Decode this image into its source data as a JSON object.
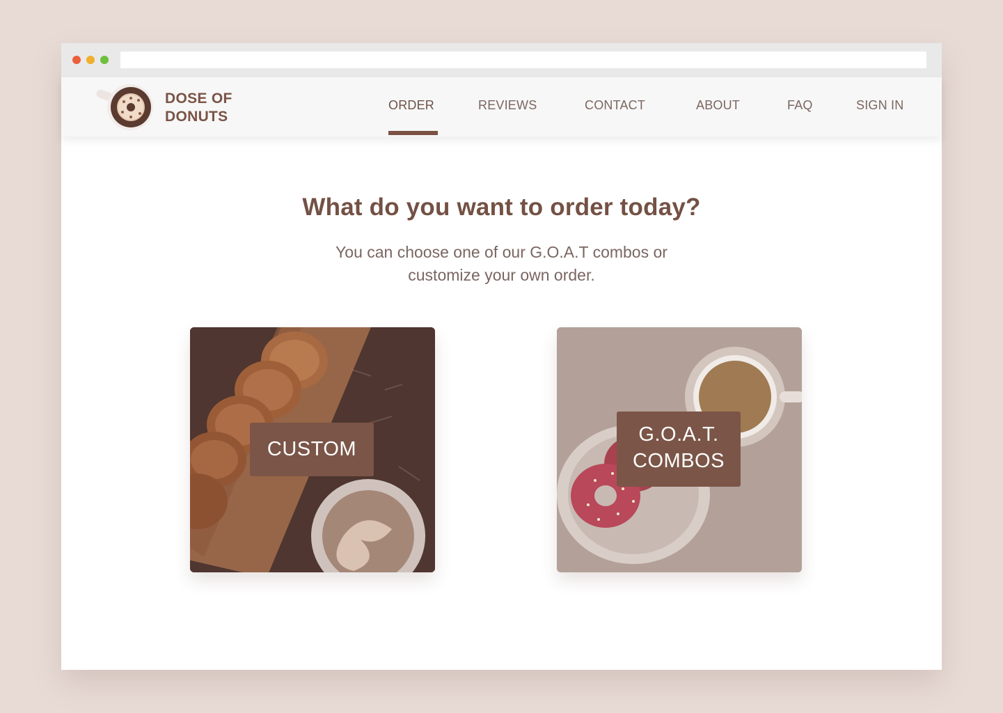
{
  "brand": {
    "line1": "DOSE OF",
    "line2": "DONUTS"
  },
  "nav": {
    "items": [
      {
        "label": "ORDER",
        "active": true
      },
      {
        "label": "REVIEWS",
        "active": false
      },
      {
        "label": "CONTACT",
        "active": false
      },
      {
        "label": "ABOUT",
        "active": false
      },
      {
        "label": "FAQ",
        "active": false
      },
      {
        "label": "SIGN IN",
        "active": false
      }
    ]
  },
  "main": {
    "title": "What do you want to order today?",
    "subtitle_line1": "You can choose one of our G.O.A.T combos or",
    "subtitle_line2": "customize your own order."
  },
  "cards": {
    "custom": {
      "label": "CUSTOM"
    },
    "combos": {
      "label_line1": "G.O.A.T.",
      "label_line2": "COMBOS"
    }
  },
  "colors": {
    "page_bg": "#e8dbd6",
    "brand_brown": "#7a5446",
    "accent": "#7b5143",
    "nav_text": "#7b6660",
    "card_label_bg": "#7b5547"
  },
  "icons": [
    "donut-logo-icon"
  ]
}
